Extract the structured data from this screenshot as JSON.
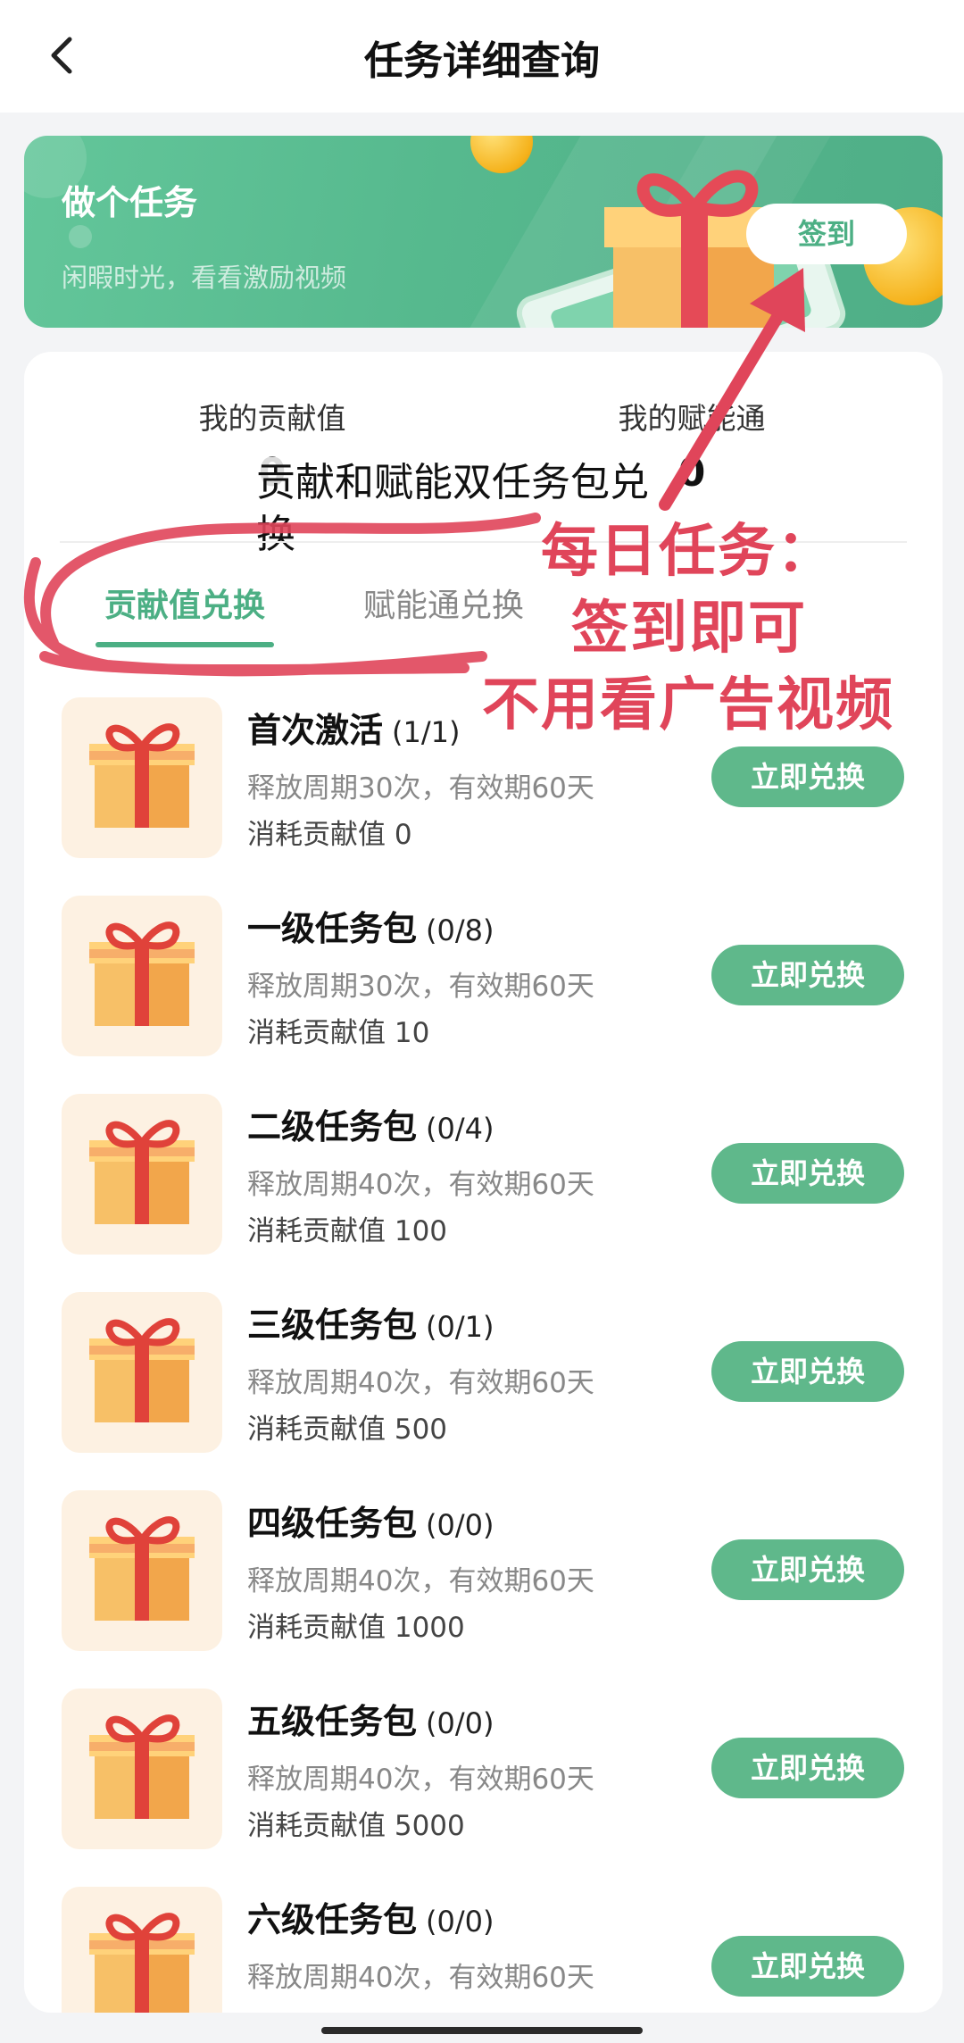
{
  "header": {
    "title": "任务详细查询"
  },
  "banner": {
    "title": "做个任务",
    "subtitle": "闲暇时光，看看激励视频",
    "button_label": "签到"
  },
  "stats": [
    {
      "label": "我的贡献值",
      "value": "0"
    },
    {
      "label": "我的赋能通",
      "value": "0"
    }
  ],
  "tabs": [
    {
      "label": "贡献值兑换",
      "active": true
    },
    {
      "label": "赋能通兑换",
      "active": false
    }
  ],
  "overlay_note": "贡献和赋能双任务包兑换",
  "annotation": [
    "每日任务：",
    "签到即可",
    "不用看广告视频"
  ],
  "redeem_label": "立即兑换",
  "items": [
    {
      "title": "首次激活",
      "count": "(1/1)",
      "desc": "释放周期30次，有效期60天",
      "cost": "消耗贡献值 0"
    },
    {
      "title": "一级任务包",
      "count": "(0/8)",
      "desc": "释放周期30次，有效期60天",
      "cost": "消耗贡献值 10"
    },
    {
      "title": "二级任务包",
      "count": "(0/4)",
      "desc": "释放周期40次，有效期60天",
      "cost": "消耗贡献值 100"
    },
    {
      "title": "三级任务包",
      "count": "(0/1)",
      "desc": "释放周期40次，有效期60天",
      "cost": "消耗贡献值 500"
    },
    {
      "title": "四级任务包",
      "count": "(0/0)",
      "desc": "释放周期40次，有效期60天",
      "cost": "消耗贡献值 1000"
    },
    {
      "title": "五级任务包",
      "count": "(0/0)",
      "desc": "释放周期40次，有效期60天",
      "cost": "消耗贡献值 5000"
    },
    {
      "title": "六级任务包",
      "count": "(0/0)",
      "desc": "释放周期40次，有效期60天",
      "cost": ""
    }
  ],
  "colors": {
    "accent": "#4caf84",
    "annotation": "#e0455a",
    "item_bg": "#fdf1e2"
  }
}
